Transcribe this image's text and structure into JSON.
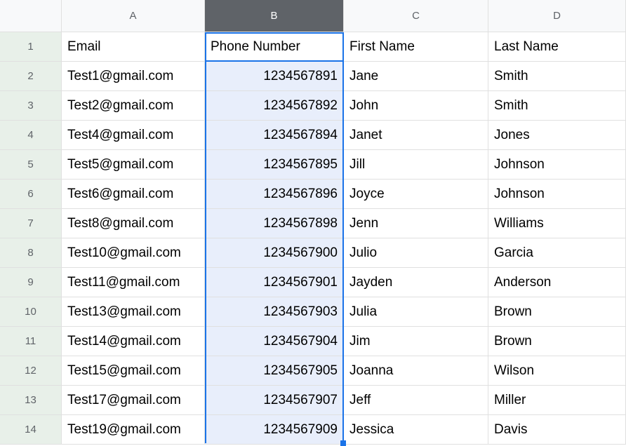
{
  "columns": [
    "A",
    "B",
    "C",
    "D"
  ],
  "row_numbers": [
    "1",
    "2",
    "3",
    "4",
    "5",
    "6",
    "7",
    "8",
    "9",
    "10",
    "11",
    "12",
    "13",
    "14"
  ],
  "selected_column": "B",
  "chart_data": {
    "type": "table",
    "headers": [
      "Email",
      "Phone Number",
      "First Name",
      "Last Name"
    ],
    "rows": [
      {
        "email": "Test1@gmail.com",
        "phone": "1234567891",
        "first": "Jane",
        "last": "Smith"
      },
      {
        "email": "Test2@gmail.com",
        "phone": "1234567892",
        "first": "John",
        "last": "Smith"
      },
      {
        "email": "Test4@gmail.com",
        "phone": "1234567894",
        "first": "Janet",
        "last": "Jones"
      },
      {
        "email": "Test5@gmail.com",
        "phone": "1234567895",
        "first": "Jill",
        "last": "Johnson"
      },
      {
        "email": "Test6@gmail.com",
        "phone": "1234567896",
        "first": "Joyce",
        "last": "Johnson"
      },
      {
        "email": "Test8@gmail.com",
        "phone": "1234567898",
        "first": "Jenn",
        "last": "Williams"
      },
      {
        "email": "Test10@gmail.com",
        "phone": "1234567900",
        "first": "Julio",
        "last": "Garcia"
      },
      {
        "email": "Test11@gmail.com",
        "phone": "1234567901",
        "first": "Jayden",
        "last": "Anderson"
      },
      {
        "email": "Test13@gmail.com",
        "phone": "1234567903",
        "first": "Julia",
        "last": "Brown"
      },
      {
        "email": "Test14@gmail.com",
        "phone": "1234567904",
        "first": "Jim",
        "last": "Brown"
      },
      {
        "email": "Test15@gmail.com",
        "phone": "1234567905",
        "first": "Joanna",
        "last": "Wilson"
      },
      {
        "email": "Test17@gmail.com",
        "phone": "1234567907",
        "first": "Jeff",
        "last": "Miller"
      },
      {
        "email": "Test19@gmail.com",
        "phone": "1234567909",
        "first": "Jessica",
        "last": "Davis"
      }
    ]
  }
}
